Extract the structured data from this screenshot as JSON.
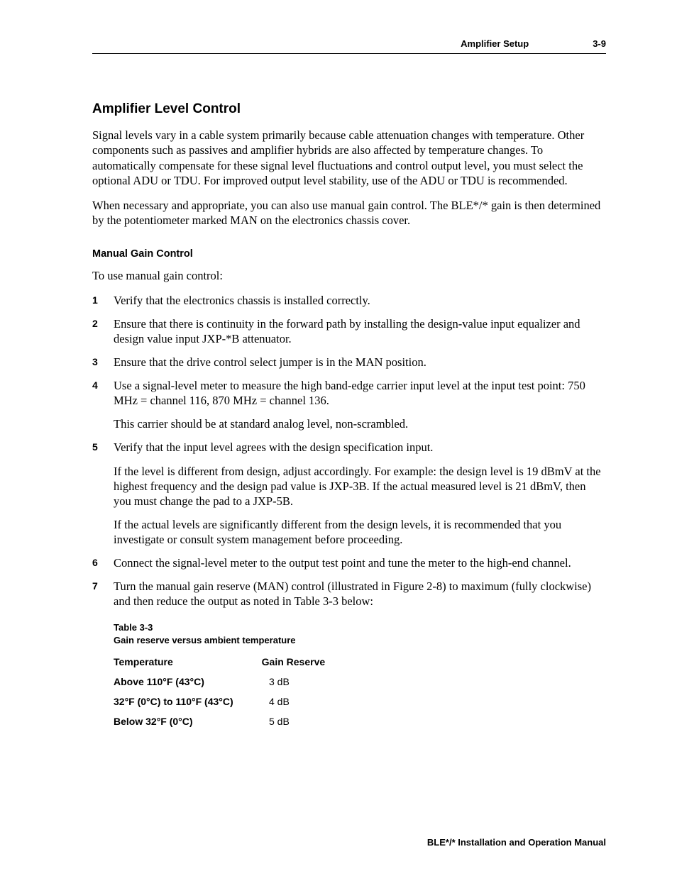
{
  "header": {
    "section": "Amplifier Setup",
    "page_number": "3-9"
  },
  "section": {
    "title": "Amplifier Level Control",
    "para1": "Signal levels vary in a cable system primarily because cable attenuation changes with temperature. Other components such as passives and amplifier hybrids are also affected by temperature changes. To automatically compensate for these signal level fluctuations and control output level, you must select the optional ADU or TDU. For improved output level stability, use of the ADU or TDU is recommended.",
    "para2_a": "When necessary and appropriate, you can also use manual gain control. The BLE*/* gain is then determined by the potentiometer marked ",
    "para2_sc": "MAN",
    "para2_b": " on the electronics chassis cover."
  },
  "subsection": {
    "title": "Manual Gain Control",
    "intro": "To use manual gain control:"
  },
  "steps": [
    {
      "n": "1",
      "paras": [
        "Verify that the electronics chassis is installed correctly."
      ]
    },
    {
      "n": "2",
      "paras": [
        "Ensure that there is continuity in the forward path by installing the design-value input equalizer and design value input JXP-*B attenuator."
      ]
    },
    {
      "n": "3",
      "pre": "Ensure that the drive control select jumper is in the ",
      "sc": "MAN",
      "post": " position."
    },
    {
      "n": "4",
      "paras": [
        "Use a signal-level meter to measure the high band-edge carrier input level at the input test point: 750 MHz = channel 116, 870 MHz = channel 136.",
        "This carrier should be at standard analog level, non-scrambled."
      ]
    },
    {
      "n": "5",
      "paras": [
        "Verify that the input level agrees with the design specification input.",
        "If the level is different from design, adjust accordingly. For example: the design level is 19 dBmV at the highest frequency and the design pad value is JXP-3B. If the actual measured level is 21 dBmV, then you must change the pad to a JXP-5B.",
        "If the actual levels are significantly different from the design levels, it is recommended that you investigate or consult system management before proceeding."
      ]
    },
    {
      "n": "6",
      "paras": [
        "Connect the signal-level meter to the output test point and tune the meter to the high-end channel."
      ]
    },
    {
      "n": "7",
      "pre": "Turn the manual gain reserve (",
      "sc": "MAN",
      "post": ") control (illustrated in Figure 2-8) to maximum (fully clockwise) and then reduce the output as noted in Table 3-3 below:"
    }
  ],
  "table": {
    "label": "Table 3-3",
    "title": "Gain reserve versus ambient temperature",
    "headers": {
      "col1": "Temperature",
      "col2": "Gain Reserve"
    },
    "rows": [
      {
        "temp": "Above 110°F (43°C)",
        "gain": "3 dB"
      },
      {
        "temp": "32°F (0°C) to 110°F (43°C)",
        "gain": "4 dB"
      },
      {
        "temp": "Below 32°F (0°C)",
        "gain": "5 dB"
      }
    ]
  },
  "footer": "BLE*/* Installation and Operation Manual"
}
